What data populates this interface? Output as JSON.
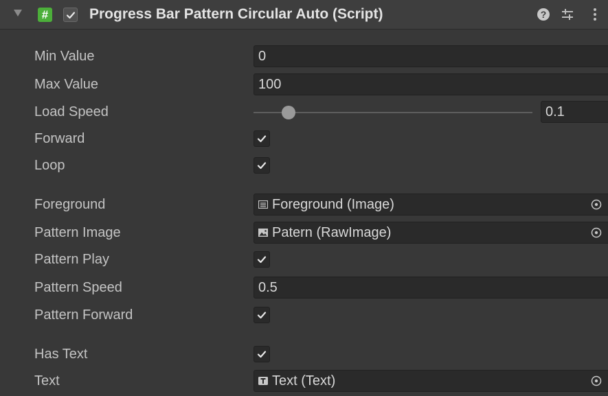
{
  "header": {
    "title": "Progress Bar Pattern Circular Auto (Script)",
    "script_icon_glyph": "#",
    "icons": [
      "foldout-arrow-icon",
      "script-icon",
      "enabled-checkbox",
      "help-icon",
      "preset-icon",
      "context-menu-icon"
    ]
  },
  "properties": {
    "min_value": {
      "label": "Min Value",
      "value": "0"
    },
    "max_value": {
      "label": "Max Value",
      "value": "100"
    },
    "load_speed": {
      "label": "Load Speed",
      "value": "0.1",
      "slider_fraction": 0.1
    },
    "forward": {
      "label": "Forward",
      "checked": true
    },
    "loop": {
      "label": "Loop",
      "checked": true
    },
    "foreground": {
      "label": "Foreground",
      "value": "Foreground (Image)",
      "icon": "image-icon"
    },
    "pattern_image": {
      "label": "Pattern Image",
      "value": "Patern (RawImage)",
      "icon": "raw-image-icon"
    },
    "pattern_play": {
      "label": "Pattern Play",
      "checked": true
    },
    "pattern_speed": {
      "label": "Pattern Speed",
      "value": "0.5"
    },
    "pattern_forward": {
      "label": "Pattern Forward",
      "checked": true
    },
    "has_text": {
      "label": "Has Text",
      "checked": true
    },
    "text": {
      "label": "Text",
      "value": "Text (Text)",
      "icon": "text-component-icon"
    }
  },
  "colors": {
    "background": "#383838",
    "header_background": "#3e3e3e",
    "field_background": "#2a2a2a",
    "script_icon": "#4caf3a"
  }
}
